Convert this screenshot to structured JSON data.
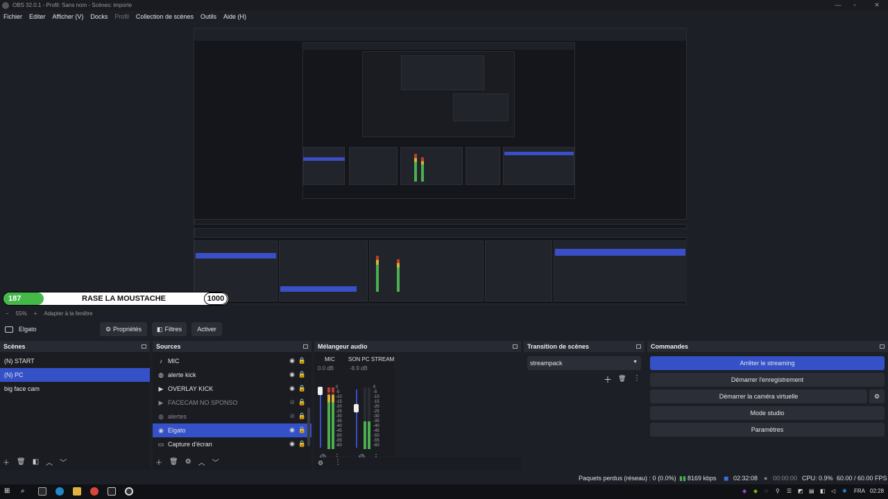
{
  "window": {
    "title": "OBS 32.0.1 - Profil: Sans nom - Scènes: importe",
    "minimize": "—",
    "maximize": "▫",
    "close": "✕"
  },
  "menu": {
    "items": [
      "Fichier",
      "Editer",
      "Afficher (V)",
      "Docks",
      "Profil",
      "Collection de scènes",
      "Outils",
      "Aide (H)"
    ]
  },
  "overlay": {
    "badge": "187",
    "slogan": "RASE LA MOUSTACHE",
    "score": "1000"
  },
  "zoom": {
    "minus": "−",
    "level": "55%",
    "plus": "+",
    "fit": "Adapter à la fenêtre"
  },
  "source_toolbar": {
    "source_name": "Elgato",
    "properties_label": "Propriétés",
    "filters_label": "Filtres",
    "activate_label": "Activer"
  },
  "scenes": {
    "title": "Scènes",
    "items": [
      "(N) START",
      "(N) PC",
      "big face cam"
    ]
  },
  "sources": {
    "title": "Sources",
    "items": [
      {
        "label": "MIC",
        "icon": "mic-icon",
        "glyph": "🎤"
      },
      {
        "label": "alerte kick",
        "icon": "globe-icon",
        "glyph": "◍"
      },
      {
        "label": "OVERLAY KICK",
        "icon": "play-icon",
        "glyph": "▶"
      },
      {
        "label": "FACECAM NO SPONSO",
        "icon": "play-icon",
        "glyph": "▶"
      },
      {
        "label": "alertes",
        "icon": "globe-icon",
        "glyph": "◍"
      },
      {
        "label": "Elgato",
        "icon": "camera-icon",
        "glyph": "◉"
      },
      {
        "label": "Capture d'écran",
        "icon": "monitor-icon",
        "glyph": "▭"
      }
    ]
  },
  "mixer": {
    "title": "Mélangeur audio",
    "scale": [
      "0",
      "-5",
      "-10",
      "-15",
      "-20",
      "-25",
      "-30",
      "-35",
      "-40",
      "-45",
      "-50",
      "-55",
      "-60"
    ],
    "channels": [
      {
        "name": "MIC",
        "db": "0.0 dB",
        "level": 0.2
      },
      {
        "name": "SON PC STREAM",
        "db": "-8.9 dB",
        "level": 0.55
      }
    ]
  },
  "transition": {
    "title": "Transition de scènes",
    "selected": "streampack"
  },
  "commands": {
    "title": "Commandes",
    "buttons": [
      "Arrêter le streaming",
      "Démarrer l'enregistrement",
      "Démarrer la caméra virtuelle",
      "Mode studio",
      "Paramètres"
    ]
  },
  "status": {
    "dropped": "Paquets perdus (réseau) : 0 (0.0%)",
    "bitrate": "8169 kbps",
    "stream_time": "02:32:08",
    "rec_time": "00:00:00",
    "cpu": "CPU: 0.9%",
    "fps": "60.00 / 60.00 FPS"
  },
  "taskbar": {
    "lang": "FRA",
    "time": "02:28"
  },
  "colors": {
    "accent": "#3451c8",
    "meter_green": "#4caf50",
    "meter_yellow": "#d4b23a",
    "meter_red": "#c0392b"
  }
}
